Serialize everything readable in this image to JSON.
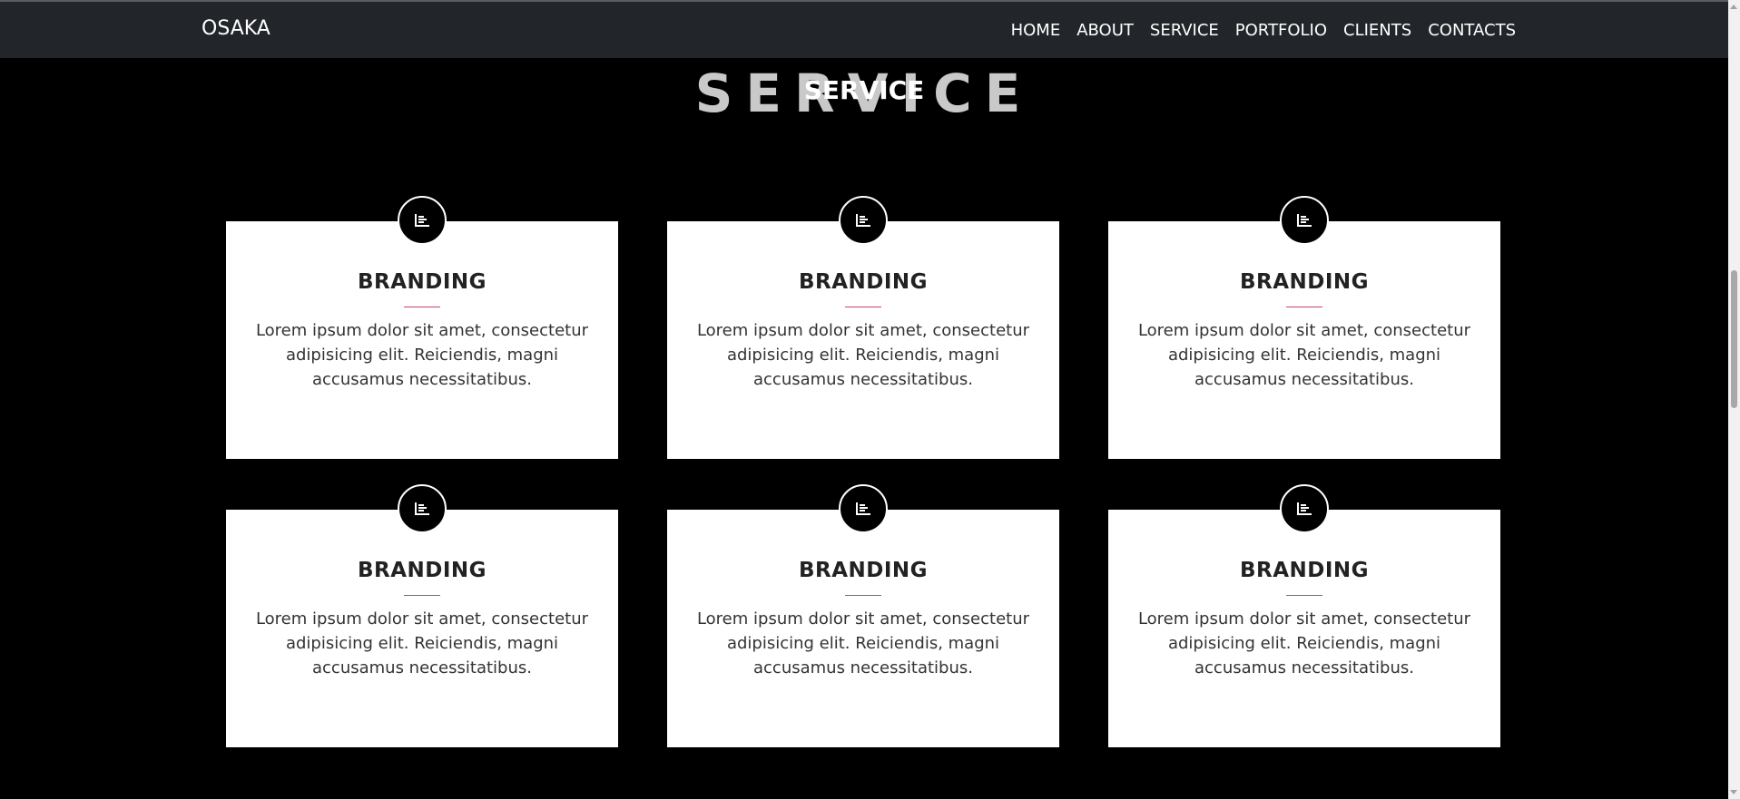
{
  "navbar": {
    "brand": "OSAKA",
    "items": [
      {
        "label": "HOME"
      },
      {
        "label": "ABOUT"
      },
      {
        "label": "SERVICE"
      },
      {
        "label": "PORTFOLIO"
      },
      {
        "label": "CLIENTS"
      },
      {
        "label": "CONTACTS"
      }
    ]
  },
  "section": {
    "background_title": "SERVICE",
    "title": "SERVICE"
  },
  "cards": [
    {
      "icon": "bar-chart-icon",
      "title": "BRANDING",
      "text": "Lorem ipsum dolor sit amet, consectetur adipisicing elit. Reiciendis, magni accusamus necessitatibus."
    },
    {
      "icon": "bar-chart-icon",
      "title": "BRANDING",
      "text": "Lorem ipsum dolor sit amet, consectetur adipisicing elit. Reiciendis, magni accusamus necessitatibus."
    },
    {
      "icon": "bar-chart-icon",
      "title": "BRANDING",
      "text": "Lorem ipsum dolor sit amet, consectetur adipisicing elit. Reiciendis, magni accusamus necessitatibus."
    },
    {
      "icon": "bar-chart-icon",
      "title": "BRANDING",
      "text": "Lorem ipsum dolor sit amet, consectetur adipisicing elit. Reiciendis, magni accusamus necessitatibus."
    },
    {
      "icon": "bar-chart-icon",
      "title": "BRANDING",
      "text": "Lorem ipsum dolor sit amet, consectetur adipisicing elit. Reiciendis, magni accusamus necessitatibus."
    },
    {
      "icon": "bar-chart-icon",
      "title": "BRANDING",
      "text": "Lorem ipsum dolor sit amet, consectetur adipisicing elit. Reiciendis, magni accusamus necessitatibus."
    }
  ],
  "colors": {
    "navbar_bg": "#222529",
    "page_bg": "#000000",
    "card_bg": "#ffffff",
    "divider_accent": "#c9436a"
  }
}
